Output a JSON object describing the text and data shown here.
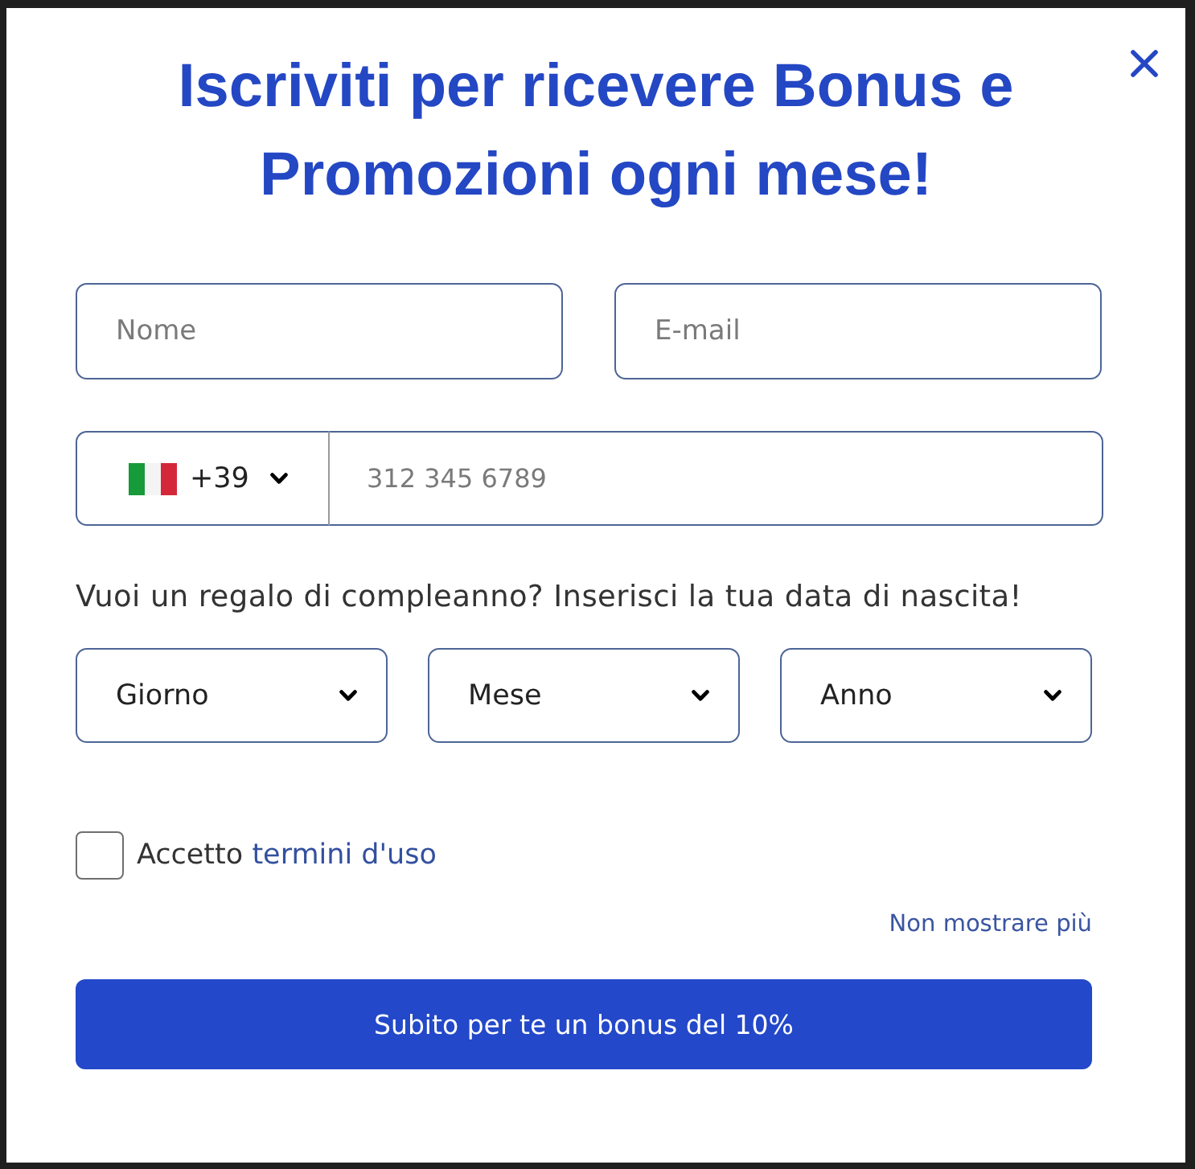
{
  "title": "Iscriviti per ricevere Bonus e Promozioni ogni mese!",
  "name_fields": [
    {
      "placeholder": "Nome"
    },
    {
      "placeholder": "E-mail"
    }
  ],
  "phone": {
    "country_code": "+39",
    "placeholder": "312 345 6789"
  },
  "birthday_prompt": "Vuoi un regalo di compleanno? Inserisci la tua data di nascita!",
  "birth_date": [
    {
      "value": "Giorno"
    },
    {
      "value": "Mese"
    },
    {
      "value": "Anno"
    }
  ],
  "terms": {
    "checked": false,
    "label": "Accetto",
    "link": "termini d'uso"
  },
  "dismiss_link": "Non mostrare più",
  "submit_button": "Subito per te un bonus del 10%"
}
